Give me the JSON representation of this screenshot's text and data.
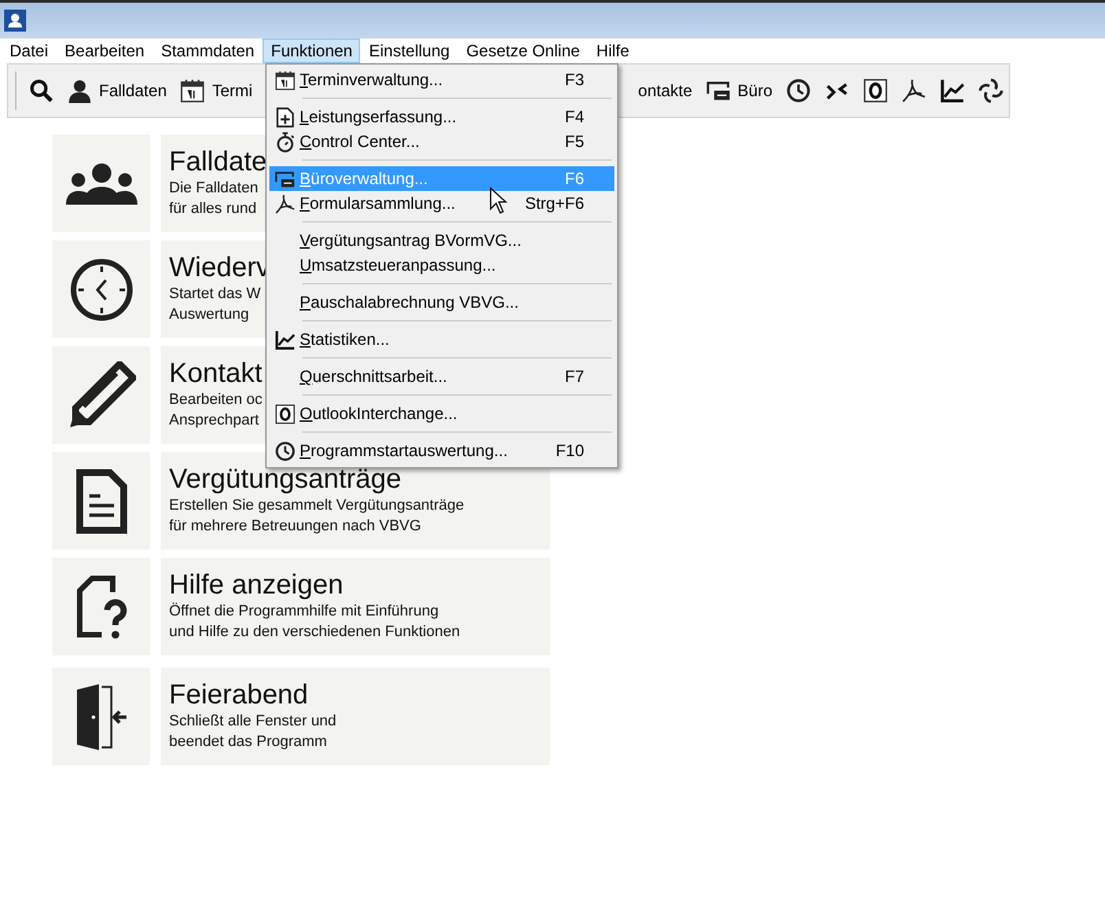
{
  "menubar": [
    {
      "label": "Datei",
      "selected": false
    },
    {
      "label": "Bearbeiten",
      "selected": false
    },
    {
      "label": "Stammdaten",
      "selected": false
    },
    {
      "label": "Funktionen",
      "selected": true
    },
    {
      "label": "Einstellung",
      "selected": false
    },
    {
      "label": "Gesetze Online",
      "selected": false
    },
    {
      "label": "Hilfe",
      "selected": false
    }
  ],
  "toolbar": {
    "left": [
      {
        "kind": "search"
      },
      {
        "kind": "person",
        "label": "Falldaten"
      },
      {
        "kind": "calendar",
        "label": "Termi"
      }
    ],
    "right": [
      {
        "kind": "text",
        "label": "ontakte"
      },
      {
        "kind": "office",
        "label": "Büro"
      },
      {
        "kind": "clock"
      },
      {
        "kind": "shrink"
      },
      {
        "kind": "outlook"
      },
      {
        "kind": "pdf"
      },
      {
        "kind": "chart"
      },
      {
        "kind": "swirl"
      }
    ]
  },
  "tiles": [
    {
      "kind": "people",
      "title": "Falldate",
      "lines": [
        "Die Falldaten",
        "für alles rund"
      ]
    },
    {
      "kind": "clock",
      "title": "Wiederv",
      "lines": [
        "Startet das W",
        "Auswertung"
      ]
    },
    {
      "kind": "pencil",
      "title": "Kontakt",
      "lines": [
        "Bearbeiten oc",
        "Ansprechpart"
      ]
    },
    {
      "kind": "document",
      "title": "Vergütungsanträge",
      "lines": [
        "Erstellen Sie gesammelt Vergütungsanträge",
        "für mehrere Betreuungen nach VBVG"
      ]
    },
    {
      "kind": "help",
      "title": "Hilfe anzeigen",
      "lines": [
        "Öffnet die Programmhilfe mit Einführung",
        "und Hilfe zu den verschiedenen Funktionen"
      ]
    },
    {
      "kind": "exit",
      "title": "Feierabend",
      "lines": [
        "Schließt alle Fenster und",
        "beendet das Programm"
      ]
    }
  ],
  "menu": [
    {
      "kind": "item",
      "label": "Terminverwaltung...",
      "shortcut": "F3",
      "selected": false
    },
    {
      "kind": "separator"
    },
    {
      "kind": "item",
      "label": "Leistungserfassung...",
      "shortcut": "F4",
      "selected": false
    },
    {
      "kind": "item",
      "label": "Control Center...",
      "shortcut": "F5",
      "selected": false
    },
    {
      "kind": "separator"
    },
    {
      "kind": "item",
      "label": "Büroverwaltung...",
      "shortcut": "F6",
      "selected": true
    },
    {
      "kind": "item",
      "label": "Formularsammlung...",
      "shortcut": "Strg+F6",
      "selected": false
    },
    {
      "kind": "separator"
    },
    {
      "kind": "item",
      "label": "Vergütungsantrag BVormVG...",
      "selected": false
    },
    {
      "kind": "item",
      "label": "Umsatzsteueranpassung...",
      "selected": false
    },
    {
      "kind": "separator"
    },
    {
      "kind": "item",
      "label": "Pauschalabrechnung VBVG...",
      "selected": false
    },
    {
      "kind": "separator"
    },
    {
      "kind": "item",
      "label": "Statistiken...",
      "selected": false
    },
    {
      "kind": "separator"
    },
    {
      "kind": "item",
      "label": "Querschnittsarbeit...",
      "shortcut": "F7",
      "selected": false
    },
    {
      "kind": "separator"
    },
    {
      "kind": "item",
      "label": "OutlookInterchange...",
      "selected": false
    },
    {
      "kind": "separator"
    },
    {
      "kind": "item",
      "label": "Programmstartauswertung...",
      "shortcut": "F10",
      "selected": false
    }
  ]
}
